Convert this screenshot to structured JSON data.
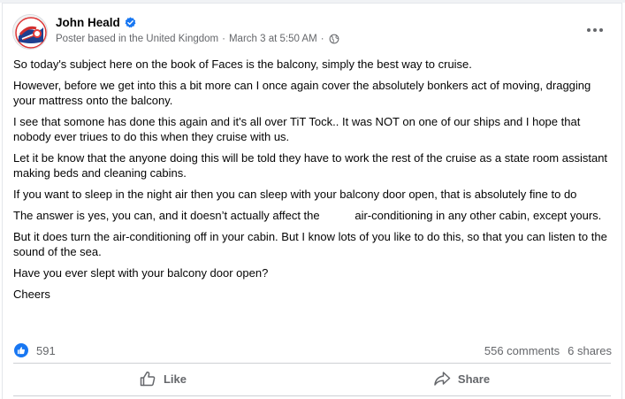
{
  "post": {
    "author": "John Heald",
    "verified": true,
    "meta": {
      "role": "Poster based in the United Kingdom",
      "date": "March 3 at 5:50 AM",
      "privacy_icon": "globe-icon"
    },
    "paragraphs": [
      "So today's subject here on the book of Faces is the balcony, simply the best way to cruise.",
      "However, before we get into this a bit more can I once again cover the absolutely bonkers act of moving, dragging your mattress onto the balcony.",
      "I see that somone has done this again and it's all over TiT Tock.. It was NOT on one of our ships and I hope that nobody ever triues to do this when they cruise with us.",
      "Let it be know that the anyone doing this will be told they have to work the rest of the cruise as a state room assistant making beds and cleaning cabins.",
      "If you want to sleep in the night air then you can sleep with your balcony door open, that is absolutely fine to do",
      "The answer is yes, you can, and it doesn’t actually affect the           air-conditioning in any other cabin, except yours.",
      "But it does turn the air-conditioning off in your cabin. But I know lots of you like to do this, so that you can listen to the sound of the sea.",
      "Have you ever slept with your balcony door open?",
      "Cheers"
    ],
    "reaction_count": "591",
    "comments": "556 comments",
    "shares": "6 shares",
    "actions": {
      "like": "Like",
      "share": "Share"
    }
  },
  "colors": {
    "accent": "#1877f2",
    "secondary_text": "#65676b",
    "divider": "#ced0d4"
  }
}
